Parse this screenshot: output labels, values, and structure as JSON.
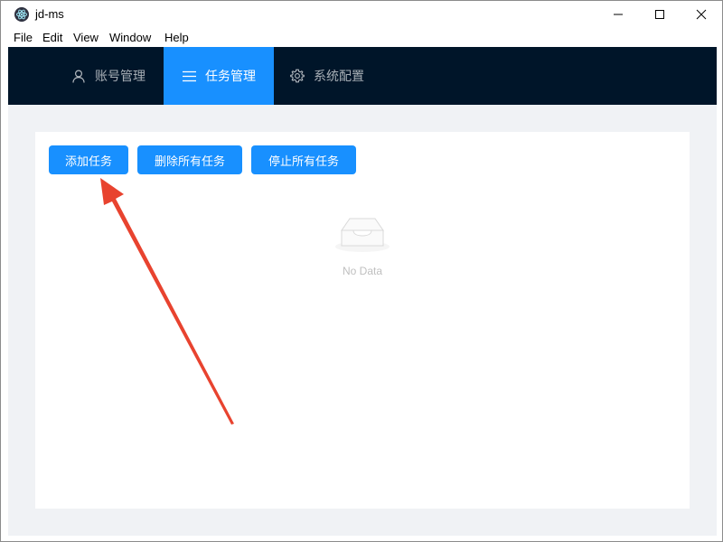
{
  "window": {
    "title": "jd-ms"
  },
  "menu": {
    "items": [
      "File",
      "Edit",
      "View",
      "Window",
      "Help"
    ]
  },
  "nav": {
    "items": [
      {
        "label": "账号管理",
        "icon": "user-icon",
        "active": false
      },
      {
        "label": "任务管理",
        "icon": "list-icon",
        "active": true
      },
      {
        "label": "系统配置",
        "icon": "gear-icon",
        "active": false
      }
    ]
  },
  "toolbar": {
    "add_label": "添加任务",
    "delete_all_label": "删除所有任务",
    "stop_all_label": "停止所有任务"
  },
  "empty": {
    "text": "No Data",
    "icon": "inbox-icon"
  },
  "colors": {
    "nav_bg": "#001529",
    "primary": "#1890ff",
    "content_bg": "#f0f2f5",
    "arrow": "#e8432f"
  }
}
